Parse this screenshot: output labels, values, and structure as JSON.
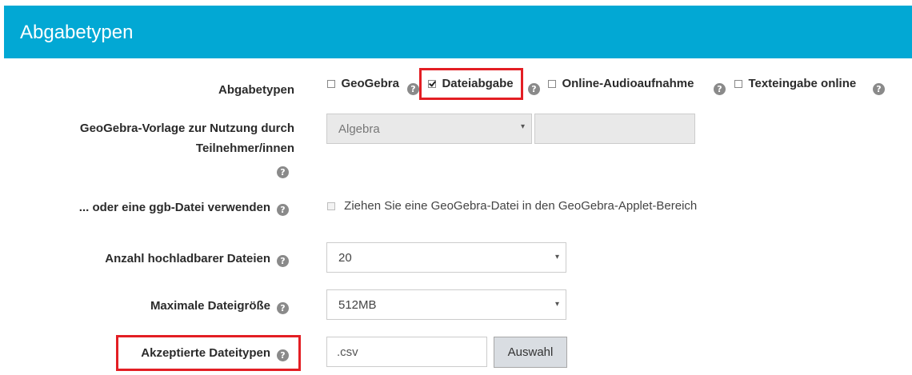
{
  "header": {
    "title": "Abgabetypen"
  },
  "form": {
    "types": {
      "label": "Abgabetypen",
      "options": [
        {
          "label": "GeoGebra",
          "checked": false
        },
        {
          "label": "Dateiabgabe",
          "checked": true
        },
        {
          "label": "Online-Audioaufnahme",
          "checked": false
        },
        {
          "label": "Texteingabe online",
          "checked": false
        }
      ]
    },
    "template": {
      "label_line1": "GeoGebra-Vorlage zur Nutzung durch",
      "label_line2": "Teilnehmer/innen",
      "select_value": "Algebra",
      "text_value": ""
    },
    "ggb_file": {
      "label": "... oder eine ggb-Datei verwenden",
      "checkbox_label": "Ziehen Sie eine GeoGebra-Datei in den GeoGebra-Applet-Bereich"
    },
    "max_files": {
      "label": "Anzahl hochladbarer Dateien",
      "value": "20"
    },
    "max_size": {
      "label": "Maximale Dateigröße",
      "value": "512MB"
    },
    "accepted_types": {
      "label": "Akzeptierte Dateitypen",
      "value": ".csv",
      "button": "Auswahl"
    }
  },
  "icons": {
    "help": "?",
    "caret": "▾"
  },
  "colors": {
    "header_bg": "#02a8d4",
    "highlight": "#e31e24"
  }
}
